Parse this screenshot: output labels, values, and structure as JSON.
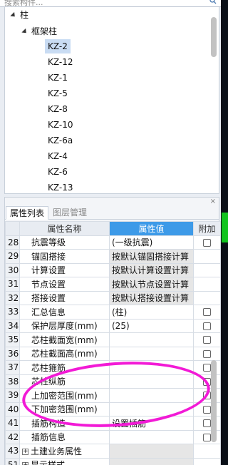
{
  "search": {
    "placeholder": "搜索构件..."
  },
  "tree": {
    "root_label": "柱",
    "group_label": "框架柱",
    "items": [
      "KZ-2",
      "KZ-12",
      "KZ-1",
      "KZ-5",
      "KZ-8",
      "KZ-10",
      "KZ-6a",
      "KZ-4",
      "KZ-6",
      "KZ-13"
    ],
    "selected": "KZ-2"
  },
  "panel": {
    "tabs": {
      "active": "属性列表",
      "inactive": "图层管理"
    },
    "headers": {
      "name": "属性名称",
      "value": "属性值",
      "extra": "附加"
    },
    "rows": [
      {
        "num": "28",
        "name": "抗震等级",
        "value": "(一级抗震)",
        "checkbox": true
      },
      {
        "num": "29",
        "name": "锚固搭接",
        "value": "按默认锚固搭接计算",
        "checkbox": false
      },
      {
        "num": "30",
        "name": "计算设置",
        "value": "按默认计算设置计算",
        "checkbox": false
      },
      {
        "num": "31",
        "name": "节点设置",
        "value": "按默认节点设置计算",
        "checkbox": false
      },
      {
        "num": "32",
        "name": "搭接设置",
        "value": "按默认搭接设置计算",
        "checkbox": false
      },
      {
        "num": "33",
        "name": "汇总信息",
        "value": "(柱)",
        "checkbox": true
      },
      {
        "num": "34",
        "name": "保护层厚度(mm)",
        "value": "(25)",
        "checkbox": true
      },
      {
        "num": "35",
        "name": "芯柱截面宽(mm)",
        "value": "",
        "checkbox": true
      },
      {
        "num": "36",
        "name": "芯柱截面高(mm)",
        "value": "",
        "checkbox": true
      },
      {
        "num": "37",
        "name": "芯柱箍筋",
        "value": "",
        "checkbox": true
      },
      {
        "num": "38",
        "name": "芯柱纵筋",
        "value": "",
        "checkbox": true
      },
      {
        "num": "39",
        "name": "上加密范围(mm)",
        "value": "",
        "checkbox": true
      },
      {
        "num": "40",
        "name": "下加密范围(mm)",
        "value": "",
        "checkbox": true
      },
      {
        "num": "41",
        "name": "插筋构造",
        "value": "设置插筋",
        "checkbox": true
      },
      {
        "num": "42",
        "name": "插筋信息",
        "value": "",
        "checkbox": true
      }
    ],
    "groups": [
      {
        "num": "43",
        "name": "土建业务属性"
      },
      {
        "num": "51",
        "name": "显示样式"
      }
    ]
  },
  "colors": {
    "accent": "#3d9ae8",
    "annotation": "#f21ad6",
    "selection": "#c9dcf3"
  }
}
